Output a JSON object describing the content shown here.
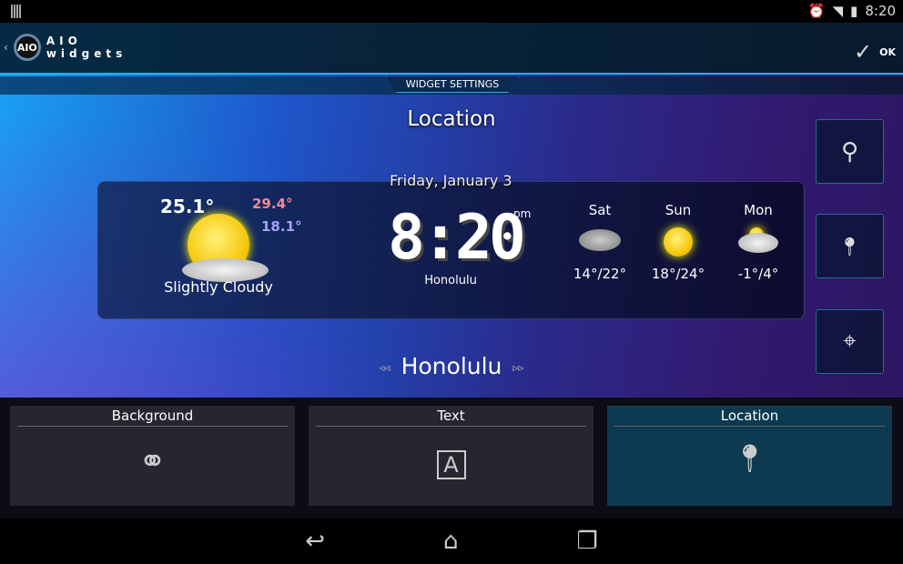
{
  "status_bar": {
    "time": "8:20",
    "icons": [
      "notification-icon",
      "alarm-icon",
      "wifi-icon",
      "battery-charging-icon"
    ]
  },
  "action_bar": {
    "logo_line1": "AIO",
    "logo_line2": "widgets",
    "logo_badge": "AIO",
    "ok_label": "OK"
  },
  "tab_strip": {
    "label": "WIDGET SETTINGS"
  },
  "page_title": "Location",
  "side_buttons": [
    "search-icon",
    "map-pin-icon",
    "crosshair-icon"
  ],
  "widget": {
    "date": "Friday, January 3",
    "current_temp": "25.1°",
    "high": "29.4°",
    "low": "18.1°",
    "condition": "Slightly Cloudy",
    "time": "8:20",
    "ampm": "pm",
    "city": "Honolulu",
    "forecast": [
      {
        "day": "Sat",
        "temps": "14°/22°",
        "icon": "thunderstorm-icon"
      },
      {
        "day": "Sun",
        "temps": "18°/24°",
        "icon": "sun-icon"
      },
      {
        "day": "Mon",
        "temps": "-1°/4°",
        "icon": "snow-cloud-icon"
      }
    ]
  },
  "location_nav": {
    "city": "Honolulu",
    "prev": "◃◃",
    "next": "▹▹"
  },
  "bottom_tabs": [
    {
      "label": "Background",
      "icon": "circles-icon"
    },
    {
      "label": "Text",
      "icon": "text-icon"
    },
    {
      "label": "Location",
      "icon": "map-pin-icon",
      "selected": true
    }
  ],
  "colors": {
    "accent": "#2ab0e6",
    "selected_tab": "#0d3a50",
    "high_temp": "#f08a96",
    "low_temp": "#a8a0ff"
  }
}
